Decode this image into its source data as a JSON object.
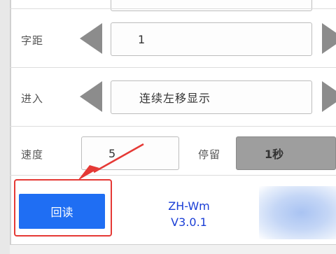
{
  "settings": {
    "spacing": {
      "label": "字距",
      "value": "1"
    },
    "enter": {
      "label": "进入",
      "value": "连续左移显示"
    },
    "speed": {
      "label": "速度",
      "value": "5"
    },
    "stay": {
      "label": "停留",
      "value": "1秒"
    }
  },
  "actions": {
    "readback_label": "回读"
  },
  "app": {
    "name": "ZH-Wm",
    "version": "V3.0.1"
  },
  "colors": {
    "accent": "#1f6ef3",
    "highlight": "#e53935",
    "version_text": "#1a3ed6"
  }
}
